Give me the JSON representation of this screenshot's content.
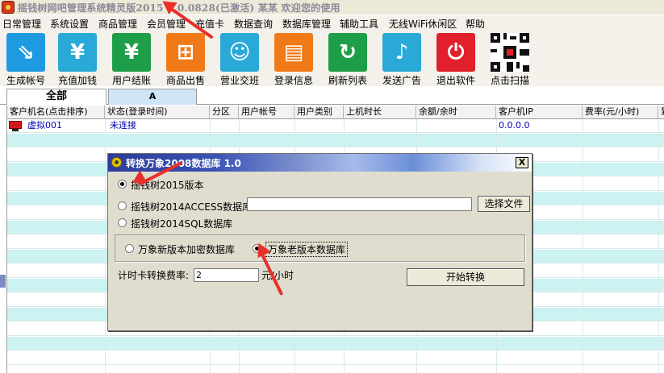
{
  "window": {
    "title": "摇钱树网吧管理系统精灵版2015 6.0.0828(已激活)   某某  欢迎您的使用"
  },
  "menu": [
    "日常管理",
    "系统设置",
    "商品管理",
    "会员管理",
    "充值卡",
    "数据查询",
    "数据库管理",
    "辅助工具",
    "无线WiFi休闲区",
    "帮助"
  ],
  "toolbar": [
    {
      "label": "生成帐号",
      "icon": "generate-account-icon",
      "color": "#1e9be0"
    },
    {
      "label": "充值加钱",
      "icon": "recharge-icon",
      "color": "#2aa8d8"
    },
    {
      "label": "用户结账",
      "icon": "checkout-icon",
      "color": "#1f9e4a"
    },
    {
      "label": "商品出售",
      "icon": "cart-icon",
      "color": "#f07a18"
    },
    {
      "label": "营业交班",
      "icon": "shift-users-icon",
      "color": "#2aa8d8"
    },
    {
      "label": "登录信息",
      "icon": "login-info-icon",
      "color": "#f07a18"
    },
    {
      "label": "刷新列表",
      "icon": "refresh-icon",
      "color": "#1f9e4a"
    },
    {
      "label": "发送广告",
      "icon": "microphone-icon",
      "color": "#2aa8d8"
    },
    {
      "label": "退出软件",
      "icon": "power-icon",
      "color": "#e0202a"
    },
    {
      "label": "点击扫描",
      "icon": "qr-code-icon",
      "color": "#111111"
    }
  ],
  "tabs": {
    "all": "全部",
    "a": "A"
  },
  "grid": {
    "columns": [
      "客户机名(点击排序)",
      "状态(登录时间)",
      "分区",
      "用户帐号",
      "用户类别",
      "上机时长",
      "余额/余时",
      "客户机IP",
      "费率(元/小时)",
      "到"
    ],
    "rows": [
      {
        "name": "虚拟001",
        "status": "未连接",
        "ip": "0.0.0.0"
      }
    ]
  },
  "dialog": {
    "title": "转换万象2008数据库 1.0",
    "close": "X",
    "options": [
      "摇钱树2015版本",
      "摇钱树2014ACCESS数据库",
      "摇钱树2014SQL数据库"
    ],
    "choose_file": "选择文件",
    "path_value": "",
    "db_options": [
      "万象新版本加密数据库",
      "万象老版本数据库"
    ],
    "rate_label": "计时卡转换费率:",
    "rate_value": "2",
    "rate_unit": "元/小时",
    "start_button": "开始转换"
  }
}
